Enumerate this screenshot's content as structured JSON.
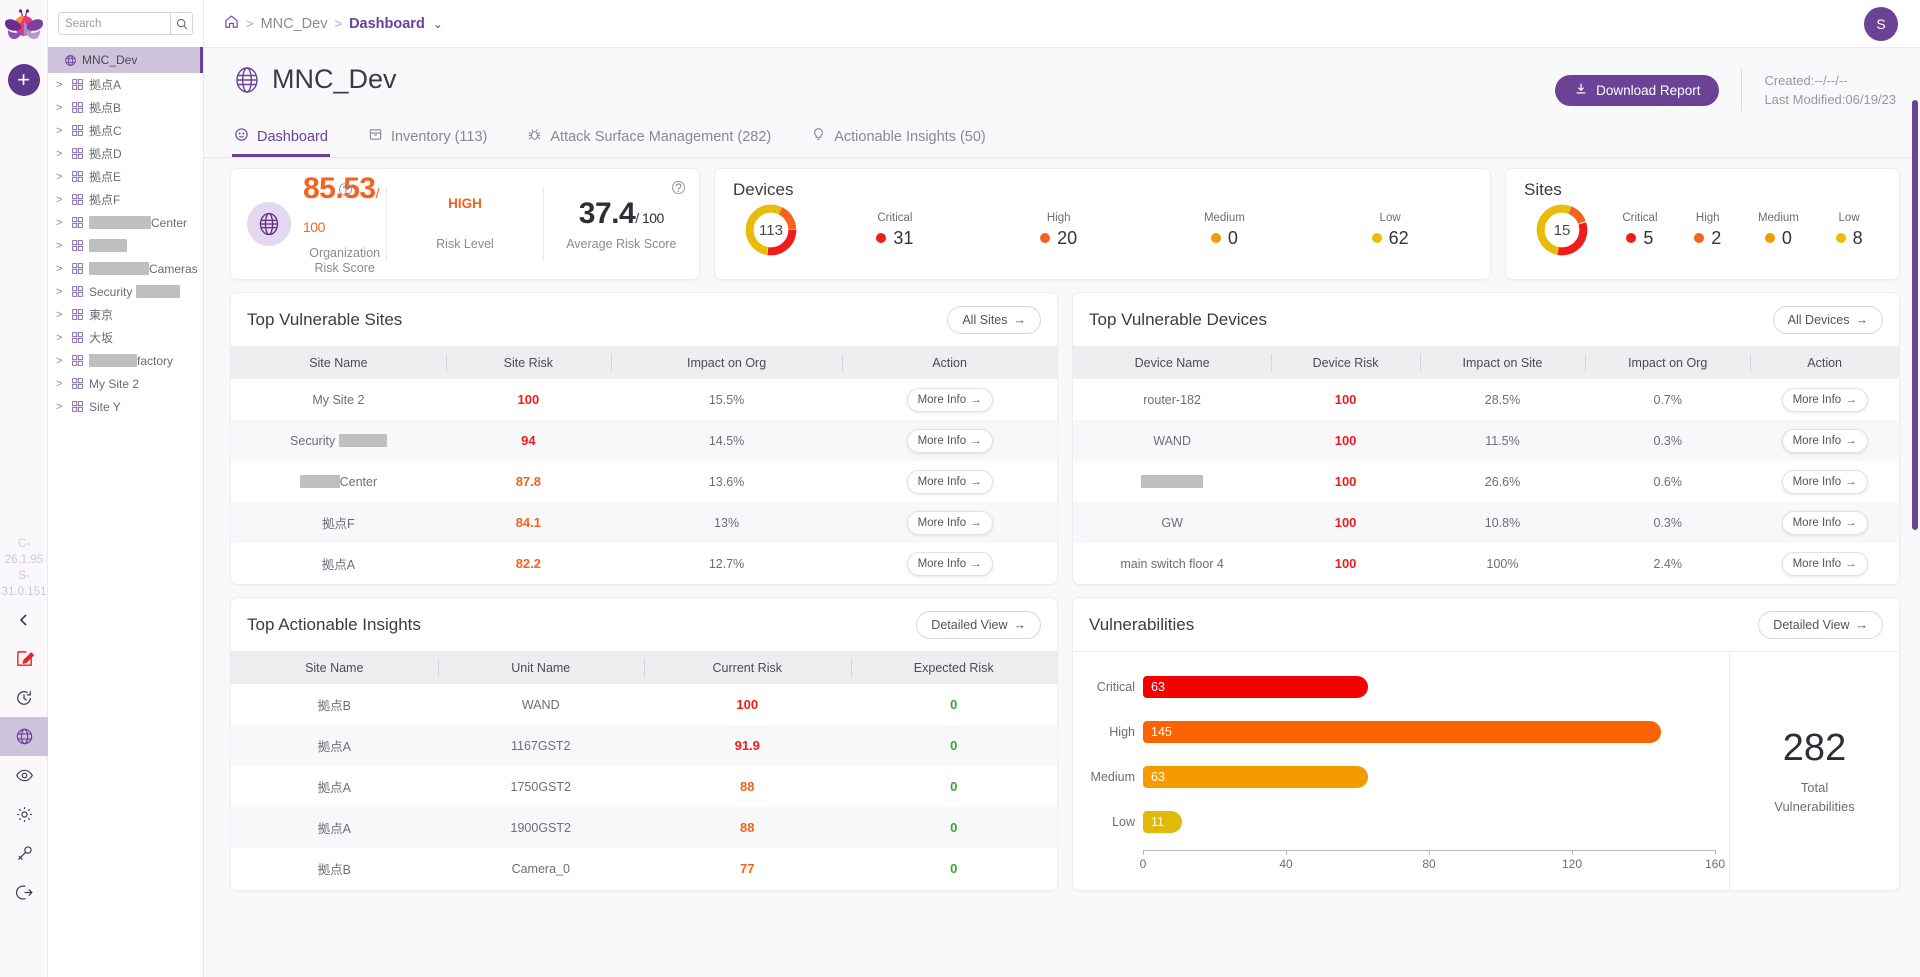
{
  "rail": {
    "logo_icon": "firefly-logo",
    "add_label": "+",
    "version": "C-26.1.95 S-31.0.151",
    "collapse_icon": "chevron-left-icon",
    "icons": [
      {
        "name": "edit-icon"
      },
      {
        "name": "history-icon"
      },
      {
        "name": "globe-icon"
      },
      {
        "name": "eye-icon"
      },
      {
        "name": "gear-icon"
      },
      {
        "name": "key-icon"
      },
      {
        "name": "logout-icon"
      }
    ]
  },
  "search": {
    "placeholder": "Search",
    "value": "",
    "icon": "search-icon"
  },
  "tree": {
    "root": {
      "label": "MNC_Dev",
      "icon": "globe-icon"
    },
    "items": [
      {
        "label": "拠点A",
        "redacted": false
      },
      {
        "label": "拠点B",
        "redacted": false
      },
      {
        "label": "拠点C",
        "redacted": false
      },
      {
        "label": "拠点D",
        "redacted": false
      },
      {
        "label": "拠点E",
        "redacted": false
      },
      {
        "label": "拠点F",
        "redacted": false
      },
      {
        "label": "Center",
        "redacted": "before",
        "redact_w": 62
      },
      {
        "label": "",
        "redacted": "only",
        "redact_w": 38
      },
      {
        "label": "Cameras",
        "redacted": "before",
        "redact_w": 60
      },
      {
        "label": "Security ",
        "redacted": "after",
        "redact_w": 44
      },
      {
        "label": "東京",
        "redacted": false
      },
      {
        "label": "大坂",
        "redacted": false
      },
      {
        "label": "factory",
        "redacted": "before",
        "redact_w": 48
      },
      {
        "label": "My Site 2",
        "redacted": false
      },
      {
        "label": "Site Y",
        "redacted": false
      }
    ]
  },
  "topbar": {
    "home_icon": "home-icon",
    "crumb_org": "MNC_Dev",
    "crumb_current": "Dashboard",
    "avatar_initial": "S"
  },
  "page": {
    "title": "MNC_Dev",
    "title_icon": "globe-icon",
    "download_label": "Download Report",
    "download_icon": "download-icon",
    "created_label": "Created:--/--/--",
    "modified_label": "Last Modified:06/19/23"
  },
  "tabs": [
    {
      "label": "Dashboard",
      "icon": "dashboard-icon",
      "active": true
    },
    {
      "label": "Inventory (113)",
      "icon": "inventory-icon",
      "active": false
    },
    {
      "label": "Attack Surface Management (282)",
      "icon": "bug-icon",
      "active": false
    },
    {
      "label": "Actionable Insights (50)",
      "icon": "bulb-icon",
      "active": false
    }
  ],
  "risk_card": {
    "icon": "globe-icon",
    "org_score": "85.53",
    "org_score_suffix": "/ 100",
    "org_score_label": "Organization Risk Score",
    "risk_level": "HIGH",
    "risk_level_label": "Risk Level",
    "avg_score": "37.4",
    "avg_score_suffix": "/ 100",
    "avg_score_label": "Average Risk Score",
    "help_icon": "help-icon"
  },
  "devices_card": {
    "title": "Devices",
    "total": "113",
    "severities": [
      {
        "name": "Critical",
        "value": "31",
        "color": "#f01c1c"
      },
      {
        "name": "High",
        "value": "20",
        "color": "#f4631e"
      },
      {
        "name": "Medium",
        "value": "0",
        "color": "#f49b00"
      },
      {
        "name": "Low",
        "value": "62",
        "color": "#e8bc0a"
      }
    ]
  },
  "sites_card": {
    "title": "Sites",
    "total": "15",
    "severities": [
      {
        "name": "Critical",
        "value": "5",
        "color": "#f01c1c"
      },
      {
        "name": "High",
        "value": "2",
        "color": "#f4631e"
      },
      {
        "name": "Medium",
        "value": "0",
        "color": "#f49b00"
      },
      {
        "name": "Low",
        "value": "8",
        "color": "#e8bc0a"
      }
    ]
  },
  "top_sites": {
    "title": "Top Vulnerable Sites",
    "action_label": "All Sites",
    "columns": [
      "Site Name",
      "Site Risk",
      "Impact on Org",
      "Action"
    ],
    "action_cell_label": "More Info",
    "rows": [
      {
        "name": "My Site 2",
        "redact": null,
        "risk": "100",
        "risk_color": "red",
        "impact": "15.5%"
      },
      {
        "name": "Security ",
        "redact": "after",
        "redact_w": 48,
        "risk": "94",
        "risk_color": "red",
        "impact": "14.5%"
      },
      {
        "name": "Center",
        "redact": "before",
        "redact_w": 40,
        "risk": "87.8",
        "risk_color": "org",
        "impact": "13.6%"
      },
      {
        "name": "拠点F",
        "redact": null,
        "risk": "84.1",
        "risk_color": "org",
        "impact": "13%"
      },
      {
        "name": "拠点A",
        "redact": null,
        "risk": "82.2",
        "risk_color": "org",
        "impact": "12.7%"
      }
    ]
  },
  "top_devices": {
    "title": "Top Vulnerable Devices",
    "action_label": "All Devices",
    "columns": [
      "Device Name",
      "Device Risk",
      "Impact on Site",
      "Impact on Org",
      "Action"
    ],
    "action_cell_label": "More Info",
    "rows": [
      {
        "name": "router-182",
        "redact": null,
        "risk": "100",
        "site": "28.5%",
        "org": "0.7%"
      },
      {
        "name": "WAND",
        "redact": null,
        "risk": "100",
        "site": "11.5%",
        "org": "0.3%"
      },
      {
        "name": "",
        "redact": "only",
        "redact_w": 62,
        "risk": "100",
        "site": "26.6%",
        "org": "0.6%"
      },
      {
        "name": "GW",
        "redact": null,
        "risk": "100",
        "site": "10.8%",
        "org": "0.3%"
      },
      {
        "name": "main switch floor 4",
        "redact": null,
        "risk": "100",
        "site": "100%",
        "org": "2.4%"
      }
    ]
  },
  "insights": {
    "title": "Top Actionable Insights",
    "action_label": "Detailed View",
    "columns": [
      "Site Name",
      "Unit Name",
      "Current Risk",
      "Expected Risk"
    ],
    "rows": [
      {
        "site": "拠点B",
        "unit": "WAND",
        "current": "100",
        "current_color": "red",
        "expected": "0"
      },
      {
        "site": "拠点A",
        "unit": "1167GST2",
        "current": "91.9",
        "current_color": "red",
        "expected": "0"
      },
      {
        "site": "拠点A",
        "unit": "1750GST2",
        "current": "88",
        "current_color": "org",
        "expected": "0"
      },
      {
        "site": "拠点A",
        "unit": "1900GST2",
        "current": "88",
        "current_color": "org",
        "expected": "0"
      },
      {
        "site": "拠点B",
        "unit": "Camera_0",
        "current": "77",
        "current_color": "org",
        "expected": "0"
      }
    ]
  },
  "vulnerabilities": {
    "title": "Vulnerabilities",
    "action_label": "Detailed View",
    "total": "282",
    "total_caption": "Total Vulnerabilities"
  },
  "chart_data": {
    "type": "bar",
    "orientation": "horizontal",
    "title": "Vulnerabilities",
    "categories": [
      "Critical",
      "High",
      "Medium",
      "Low"
    ],
    "values": [
      63,
      145,
      63,
      11
    ],
    "colors": [
      "#f40000",
      "#fa6400",
      "#f59b00",
      "#e0b90b"
    ],
    "xlabel": "",
    "ylabel": "",
    "xlim": [
      0,
      160
    ],
    "xticks": [
      0,
      40,
      80,
      120,
      160
    ],
    "grid": false,
    "legend": false,
    "annotation_total": 282
  }
}
